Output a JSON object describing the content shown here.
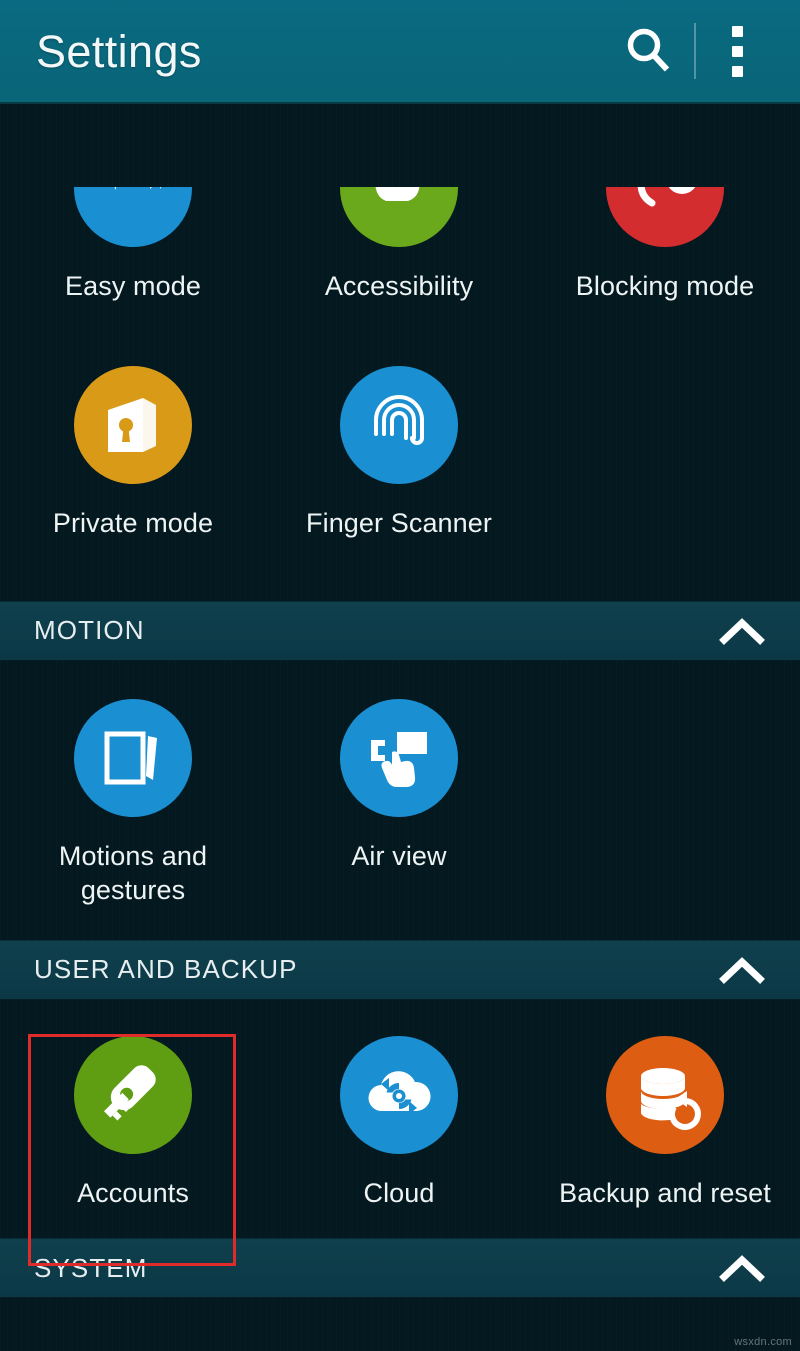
{
  "appbar": {
    "title": "Settings",
    "search_icon": "search-icon",
    "overflow_icon": "more-vertical-icon",
    "accent_color": "#0a6a81"
  },
  "colors": {
    "background": "#04191f",
    "section_header": "#0f404d",
    "highlight": "#e02b2b",
    "blue": "#1a8fd1",
    "green": "#5f9e13",
    "red": "#d42d2f",
    "amber": "#d99a18",
    "orange": "#dd5e12"
  },
  "sections": [
    {
      "id": "top-partial",
      "header": null,
      "items": [
        {
          "label": "Easy mode",
          "icon": "easy-mode-icon",
          "color": "#1a8fd1"
        },
        {
          "label": "Accessibility",
          "icon": "accessibility-icon",
          "color": "#6aa91b"
        },
        {
          "label": "Blocking mode",
          "icon": "blocking-mode-icon",
          "color": "#d42d2f"
        }
      ]
    },
    {
      "id": "personalization-rest",
      "header": null,
      "items": [
        {
          "label": "Private mode",
          "icon": "private-mode-icon",
          "color": "#d99a18"
        },
        {
          "label": "Finger Scanner",
          "icon": "fingerprint-icon",
          "color": "#1a8fd1"
        }
      ]
    },
    {
      "id": "motion",
      "header": {
        "label": "MOTION",
        "chevron": "chevron-up-icon"
      },
      "items": [
        {
          "label": "Motions and gestures",
          "icon": "motions-gestures-icon",
          "color": "#1a8fd1"
        },
        {
          "label": "Air view",
          "icon": "air-view-icon",
          "color": "#1a8fd1"
        }
      ]
    },
    {
      "id": "user-and-backup",
      "header": {
        "label": "USER AND BACKUP",
        "chevron": "chevron-up-icon"
      },
      "items": [
        {
          "label": "Accounts",
          "icon": "key-icon",
          "color": "#5f9e13",
          "highlighted": true
        },
        {
          "label": "Cloud",
          "icon": "cloud-sync-icon",
          "color": "#1a8fd1",
          "highlighted": false
        },
        {
          "label": "Backup and reset",
          "icon": "backup-reset-icon",
          "color": "#dd5e12",
          "highlighted": false
        }
      ]
    },
    {
      "id": "system",
      "header": {
        "label": "SYSTEM",
        "chevron": "chevron-up-icon"
      },
      "items": []
    }
  ],
  "watermark": "wsxdn.com"
}
